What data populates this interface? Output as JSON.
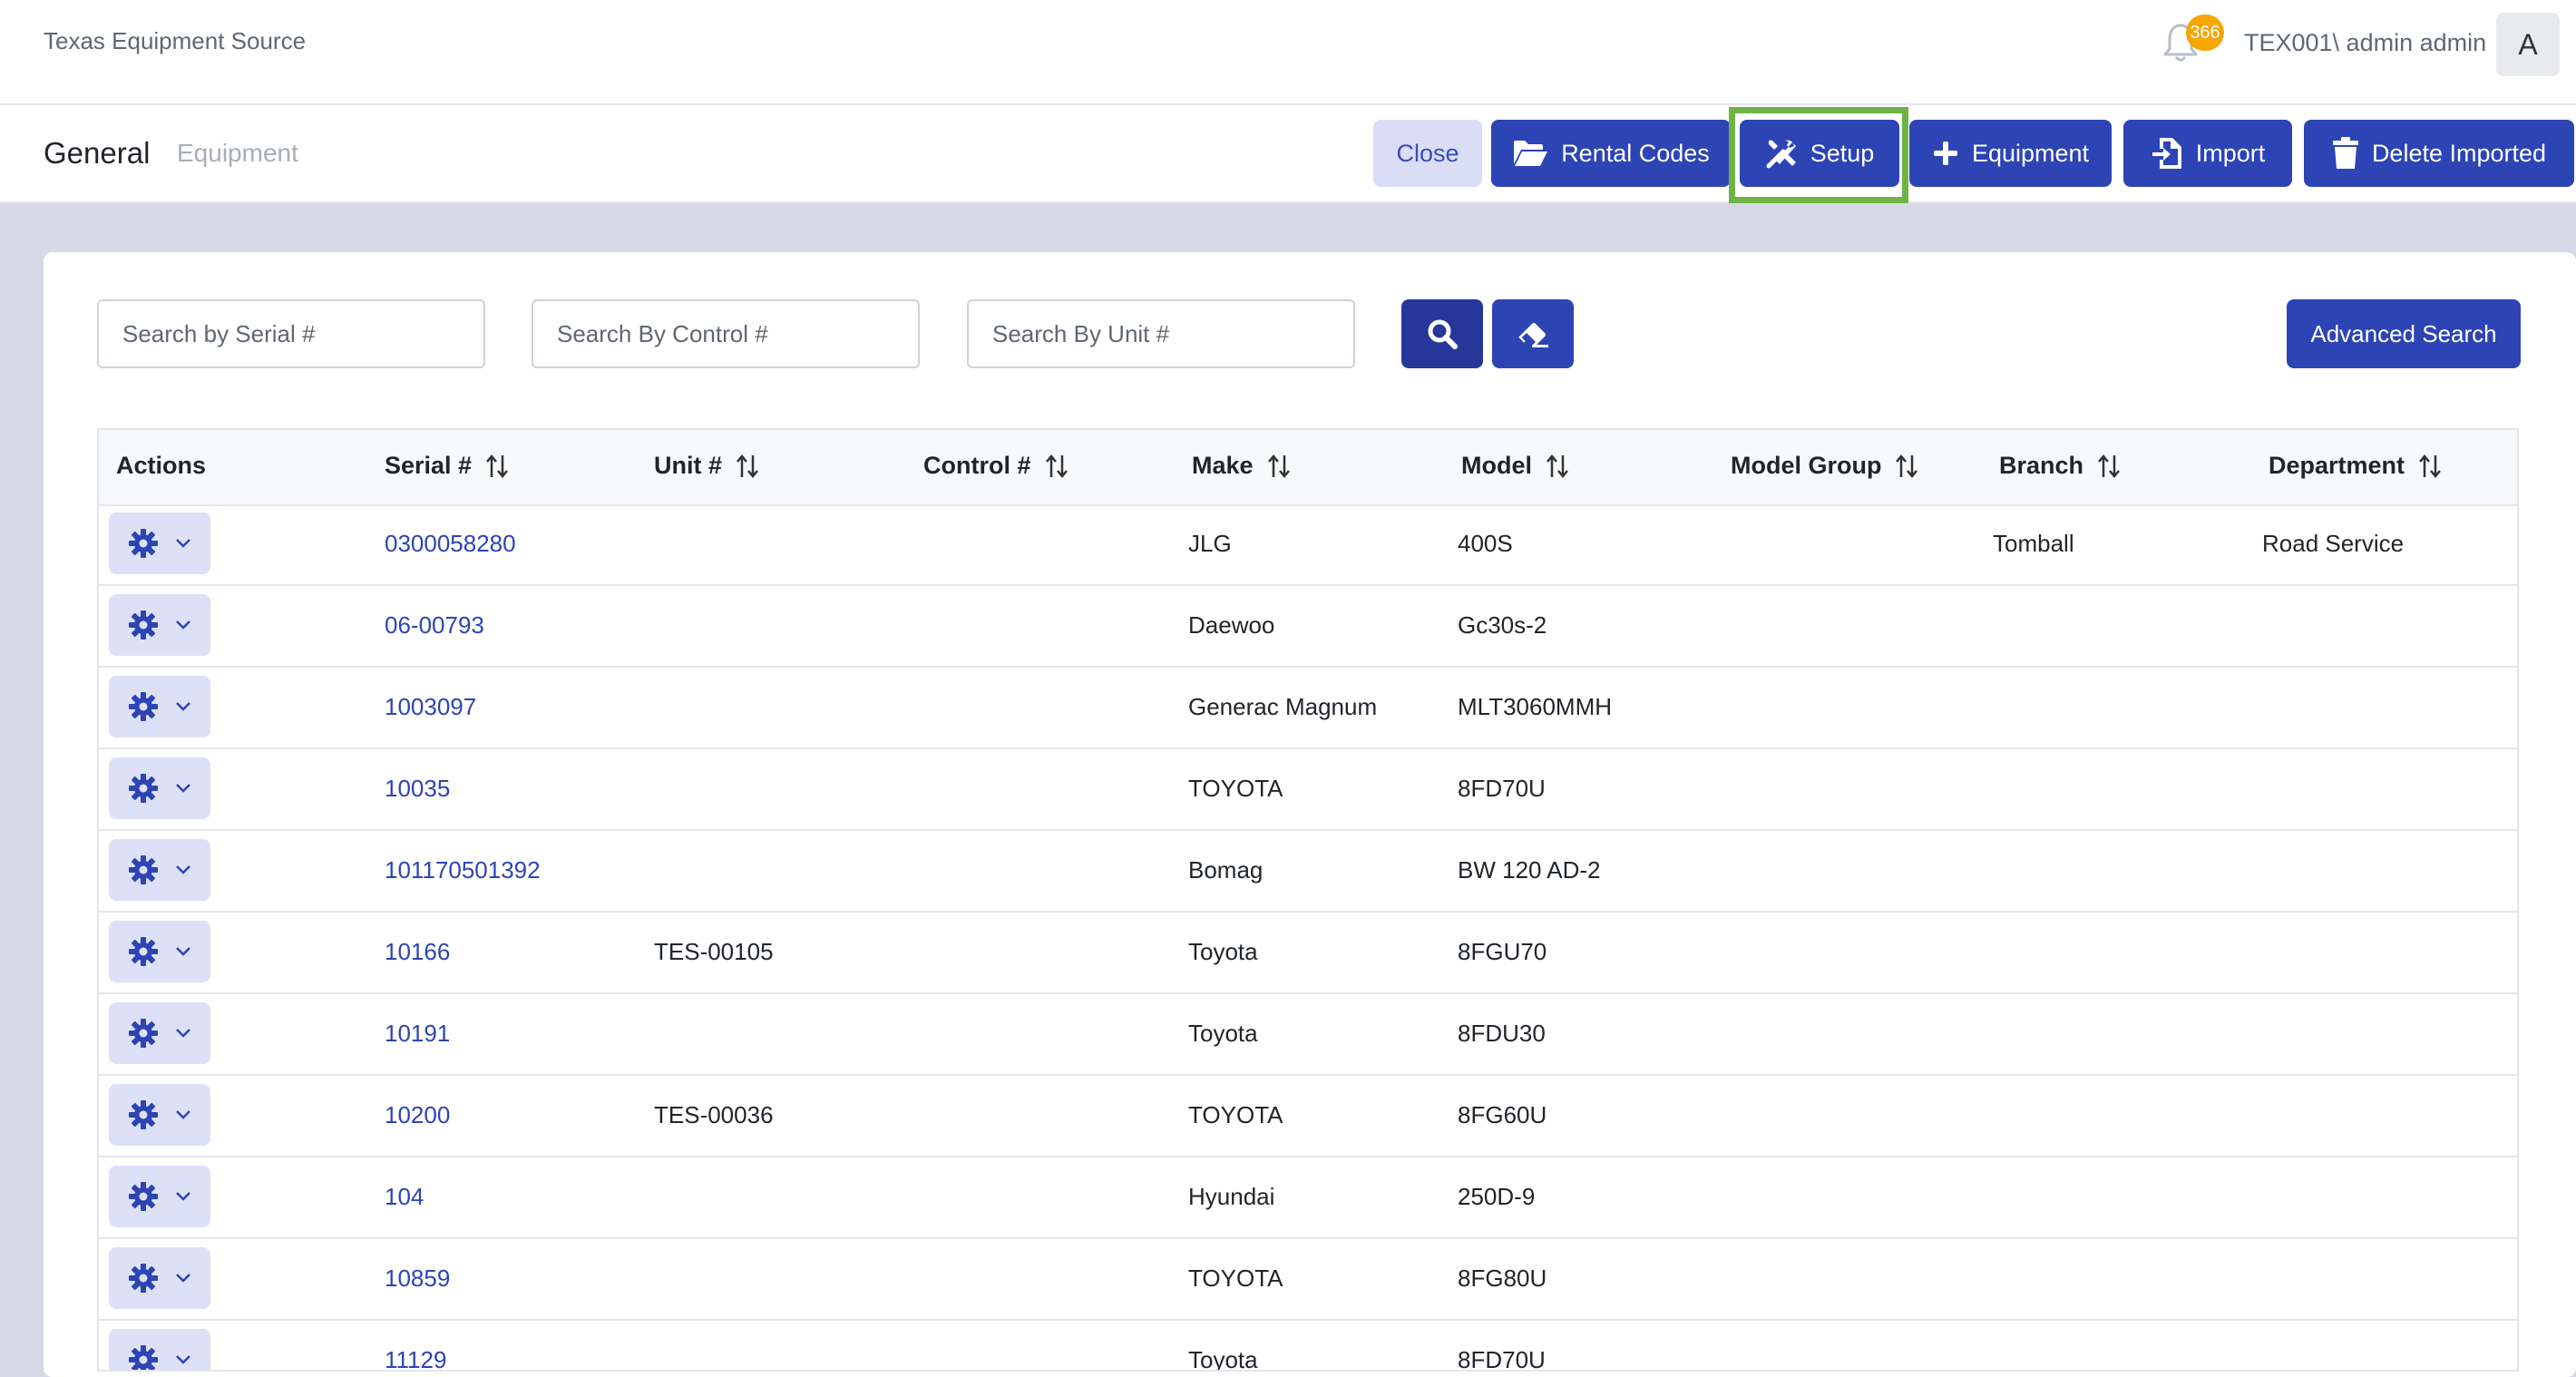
{
  "app": {
    "brand": "Texas Equipment Source"
  },
  "header": {
    "notification_count": "366",
    "user_name": "TEX001\\ admin admin",
    "avatar_letter": "A"
  },
  "subheader": {
    "tabs": [
      {
        "label": "General",
        "active": true
      },
      {
        "label": "Equipment",
        "active": false
      }
    ],
    "buttons": {
      "close": "Close",
      "rental_codes": "Rental Codes",
      "setup": "Setup",
      "equipment": "Equipment",
      "import": "Import",
      "delete_imported": "Delete Imported"
    }
  },
  "search": {
    "serial_placeholder": "Search by Serial #",
    "control_placeholder": "Search By Control #",
    "unit_placeholder": "Search By Unit #",
    "advanced_label": "Advanced Search"
  },
  "table": {
    "columns": [
      "Actions",
      "Serial #",
      "Unit #",
      "Control #",
      "Make",
      "Model",
      "Model Group",
      "Branch",
      "Department"
    ],
    "rows": [
      {
        "serial": "0300058280",
        "unit": "",
        "control": "",
        "make": "JLG",
        "model": "400S",
        "model_group": "",
        "branch": "Tomball",
        "department": "Road Service"
      },
      {
        "serial": "06-00793",
        "unit": "",
        "control": "",
        "make": "Daewoo",
        "model": "Gc30s-2",
        "model_group": "",
        "branch": "",
        "department": ""
      },
      {
        "serial": "1003097",
        "unit": "",
        "control": "",
        "make": "Generac Magnum",
        "model": "MLT3060MMH",
        "model_group": "",
        "branch": "",
        "department": ""
      },
      {
        "serial": "10035",
        "unit": "",
        "control": "",
        "make": "TOYOTA",
        "model": "8FD70U",
        "model_group": "",
        "branch": "",
        "department": ""
      },
      {
        "serial": "101170501392",
        "unit": "",
        "control": "",
        "make": "Bomag",
        "model": "BW 120 AD-2",
        "model_group": "",
        "branch": "",
        "department": ""
      },
      {
        "serial": "10166",
        "unit": "TES-00105",
        "control": "",
        "make": "Toyota",
        "model": "8FGU70",
        "model_group": "",
        "branch": "",
        "department": ""
      },
      {
        "serial": "10191",
        "unit": "",
        "control": "",
        "make": "Toyota",
        "model": "8FDU30",
        "model_group": "",
        "branch": "",
        "department": ""
      },
      {
        "serial": "10200",
        "unit": "TES-00036",
        "control": "",
        "make": "TOYOTA",
        "model": "8FG60U",
        "model_group": "",
        "branch": "",
        "department": ""
      },
      {
        "serial": "104",
        "unit": "",
        "control": "",
        "make": "Hyundai",
        "model": "250D-9",
        "model_group": "",
        "branch": "",
        "department": ""
      },
      {
        "serial": "10859",
        "unit": "",
        "control": "",
        "make": "TOYOTA",
        "model": "8FG80U",
        "model_group": "",
        "branch": "",
        "department": ""
      },
      {
        "serial": "11129",
        "unit": "",
        "control": "",
        "make": "Toyota",
        "model": "8FD70U",
        "model_group": "",
        "branch": "",
        "department": ""
      }
    ]
  },
  "colors": {
    "primary": "#2d44b5",
    "highlight": "#6fb345",
    "badge": "#f7a600"
  }
}
